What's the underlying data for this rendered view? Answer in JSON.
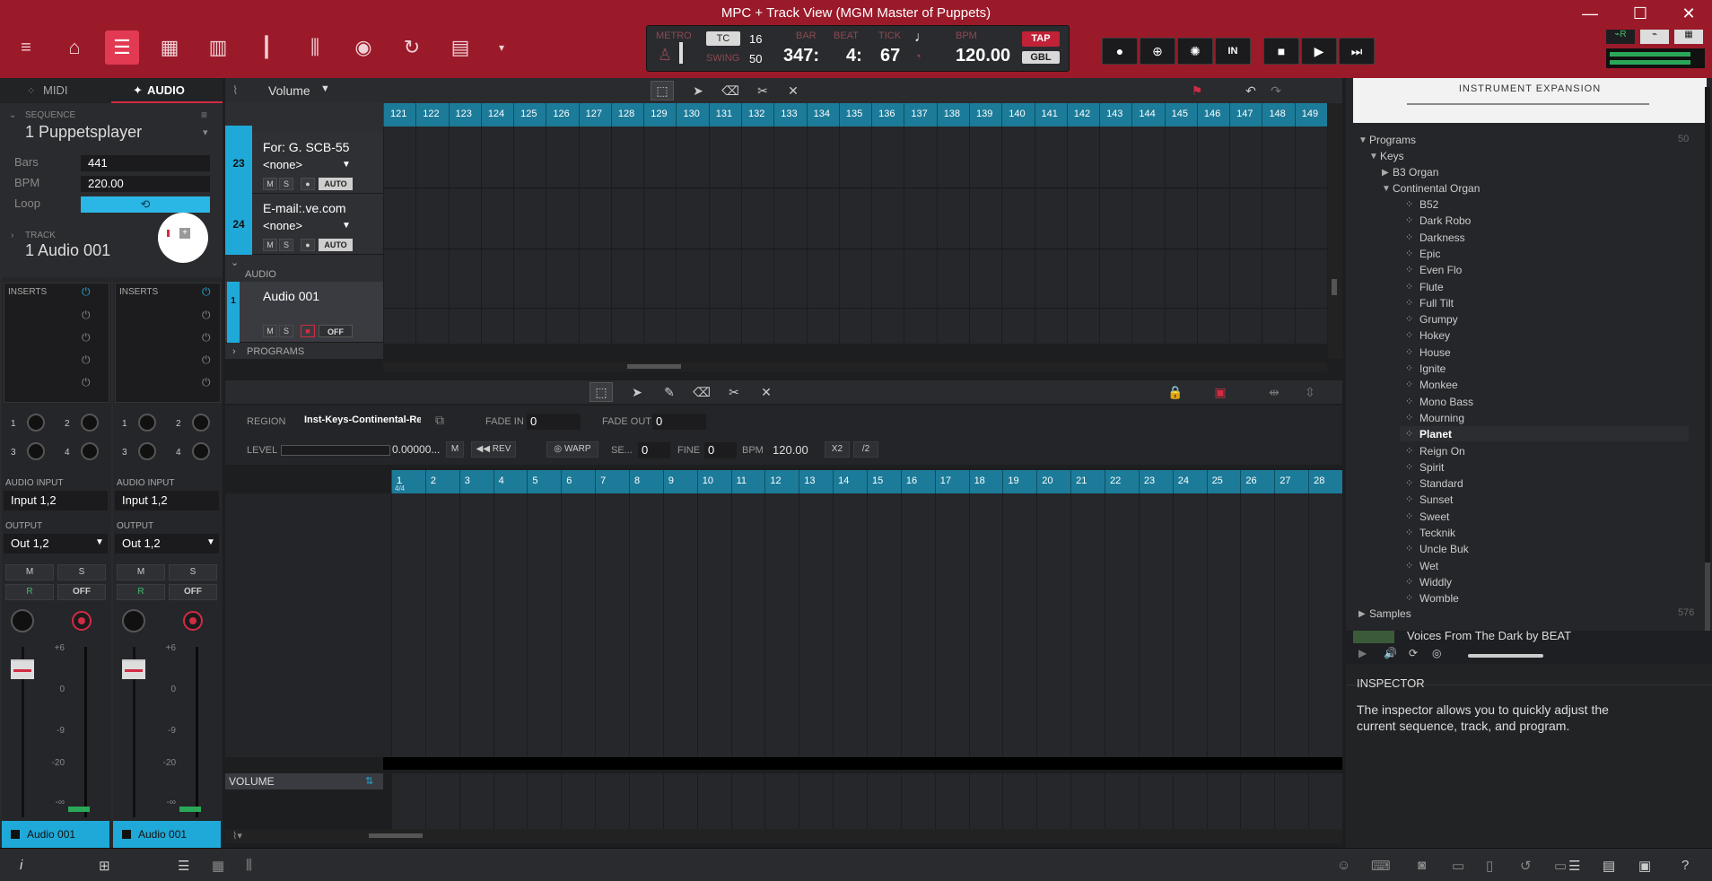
{
  "window": {
    "title": "MPC + Track View (MGM Master of Puppets)"
  },
  "transport": {
    "metro_label": "METRO",
    "tc_label": "TC",
    "tc_value": "16",
    "swing_label": "SWING",
    "swing_value": "50",
    "bar_label": "BAR",
    "bar_value": "347:",
    "beat_label": "BEAT",
    "beat_value": "4:",
    "tick_label": "TICK",
    "tick_value": "67",
    "bpm_label": "BPM",
    "bpm_value": "120.00",
    "tap_label": "TAP",
    "gbl_label": "GBL",
    "in_label": "IN"
  },
  "left_panel": {
    "tab_midi": "MIDI",
    "tab_audio": "AUDIO",
    "sequence_label": "SEQUENCE",
    "sequence_name": "1 Puppetsplayer",
    "bars_label": "Bars",
    "bars_value": "441",
    "bpm_label": "BPM",
    "bpm_value": "220.00",
    "loop_label": "Loop",
    "track_label": "TRACK",
    "track_name": "1 Audio 001",
    "strips": [
      {
        "inserts": "INSERTS",
        "audio_input_label": "AUDIO INPUT",
        "audio_input": "Input 1,2",
        "output_label": "OUTPUT",
        "output": "Out 1,2",
        "m": "M",
        "s": "S",
        "r": "R",
        "off": "OFF",
        "name": "Audio 001"
      },
      {
        "inserts": "INSERTS",
        "audio_input_label": "AUDIO INPUT",
        "audio_input": "Input 1,2",
        "output_label": "OUTPUT",
        "output": "Out 1,2",
        "m": "M",
        "s": "S",
        "r": "R",
        "off": "OFF",
        "name": "Audio 001"
      }
    ],
    "send_labels": [
      "1",
      "2",
      "3",
      "4"
    ],
    "db_labels": [
      "+6",
      "0",
      "-9",
      "-20",
      "-∞"
    ]
  },
  "track_view": {
    "param_dropdown": "Volume",
    "ruler_top": [
      "121",
      "122",
      "123",
      "124",
      "125",
      "126",
      "127",
      "128",
      "129",
      "130",
      "131",
      "132",
      "133",
      "134",
      "135",
      "136",
      "137",
      "138",
      "139",
      "140",
      "141",
      "142",
      "143",
      "144",
      "145",
      "146",
      "147",
      "148",
      "149"
    ],
    "tracks": [
      {
        "num": "23",
        "title": "For: G. SCB-55",
        "program": "<none>",
        "m": "M",
        "s": "S",
        "auto": "AUTO"
      },
      {
        "num": "24",
        "title": "E-mail:.ve.com",
        "program": "<none>",
        "m": "M",
        "s": "S",
        "auto": "AUTO"
      }
    ],
    "audio_section": "AUDIO",
    "audio_track": {
      "num": "1",
      "title": "Audio 001",
      "m": "M",
      "s": "S",
      "off": "OFF"
    },
    "programs_section": "PROGRAMS"
  },
  "region_editor": {
    "region_label": "REGION",
    "region_value": "Inst-Keys-Continental-Rei",
    "fade_in_label": "FADE IN",
    "fade_in_value": "0",
    "fade_out_label": "FADE OUT",
    "fade_out_value": "0",
    "level_label": "LEVEL",
    "level_value": "0.00000...",
    "m": "M",
    "rev": "REV",
    "warp": "WARP",
    "semi_label": "SE...",
    "semi_value": "0",
    "fine_label": "FINE",
    "fine_value": "0",
    "bpm_label": "BPM",
    "bpm_value": "120.00",
    "x2": "X2",
    "half": "/2",
    "ruler": [
      "1",
      "2",
      "3",
      "4",
      "5",
      "6",
      "7",
      "8",
      "9",
      "10",
      "11",
      "12",
      "13",
      "14",
      "15",
      "16",
      "17",
      "18",
      "19",
      "20",
      "21",
      "22",
      "23",
      "24",
      "25",
      "26",
      "27",
      "28"
    ],
    "time_sig": "4/4",
    "volume_label": "VOLUME"
  },
  "browser": {
    "banner_line1": "INSTRUMENT EXPANSION",
    "programs_label": "Programs",
    "programs_count": "50",
    "keys": "Keys",
    "b3_organ": "B3 Organ",
    "continental_organ": "Continental Organ",
    "items": [
      "B52",
      "Dark Robo",
      "Darkness",
      "Epic",
      "Even Flo",
      "Flute",
      "Full Tilt",
      "Grumpy",
      "Hokey",
      "House",
      "Ignite",
      "Monkee",
      "Mono Bass",
      "Mourning",
      "Planet",
      "Reign On",
      "Spirit",
      "Standard",
      "Sunset",
      "Sweet",
      "Tecknik",
      "Uncle Buk",
      "Wet",
      "Widdly",
      "Womble"
    ],
    "selected": "Planet",
    "samples_label": "Samples",
    "samples_count": "576",
    "preview_title": "Voices From The Dark by BEAT"
  },
  "inspector": {
    "title": "INSPECTOR",
    "text": "The inspector allows you to quickly adjust the current sequence, track, and program."
  },
  "colors": {
    "titlebar": "#9b1a2a",
    "accent": "#1fa9d8",
    "record": "#d12c44"
  }
}
